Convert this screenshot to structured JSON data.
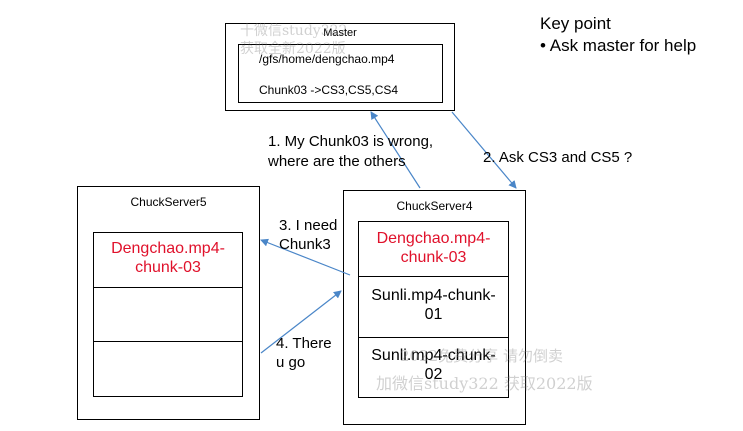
{
  "master": {
    "title": "Master",
    "path": "/gfs/home/dengchao.mp4",
    "mapping": "Chunk03 ->CS3,CS5,CS4"
  },
  "key_point": {
    "title": "Key point",
    "bullet": "• Ask master for help"
  },
  "server5": {
    "title": "ChuckServer5",
    "chunks": [
      "Dengchao.mp4-\nchunk-03",
      "",
      ""
    ]
  },
  "server4": {
    "title": "ChuckServer4",
    "chunks": [
      "Dengchao.mp4-\nchunk-03",
      "Sunli.mp4-chunk-\n01",
      "Sunli.mp4-chunk-\n02"
    ]
  },
  "messages": {
    "step1": "1. My Chunk03 is wrong,\nwhere are the others",
    "step2": "2. Ask CS3 and CS5 ?",
    "step3": "3. I need\nChunk3",
    "step4": "4. There\nu go"
  },
  "colors": {
    "arrow": "#4a86c8",
    "highlight": "#e0112b"
  },
  "watermarks": [
    "十微信study322",
    "获取全新2022版",
    "2022免费分享 请勿倒卖",
    "加微信study322 获取2022版"
  ]
}
